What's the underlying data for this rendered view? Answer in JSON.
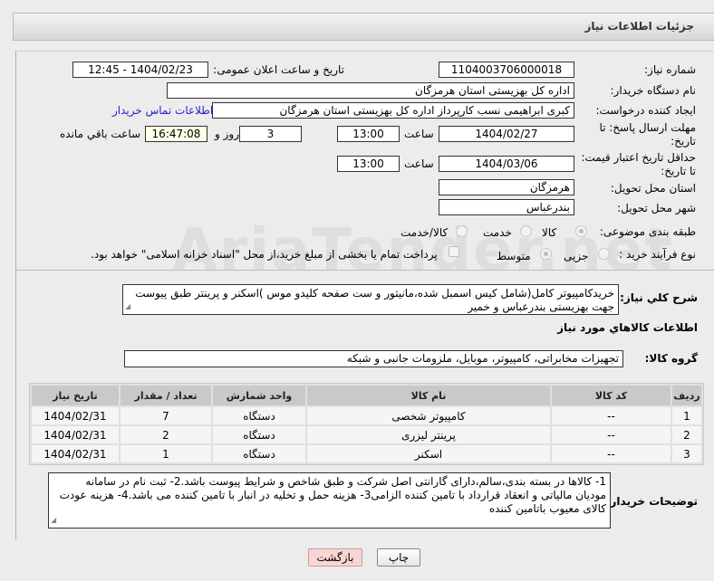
{
  "header": {
    "title": "جزئیات اطلاعات نیاز"
  },
  "form": {
    "need_number_label": "شماره نیاز:",
    "need_number": "1104003706000018",
    "announce_label": "تاریخ و ساعت اعلان عمومی:",
    "announce_value": "1404/02/23 - 12:45",
    "buyer_org_label": "نام دستگاه خریدار:",
    "buyer_org": "اداره کل بهزیستی استان هرمزگان",
    "creator_label": "ایجاد کننده درخواست:",
    "creator": "کبری  ابراهیمی نسب کارپرداز اداره کل بهزیستی استان هرمزگان",
    "contact_link": "اطلاعات تماس خریدار",
    "deadline_label": "مهلت ارسال پاسخ: تا تاریخ:",
    "deadline_date": "1404/02/27",
    "time_label": "ساعت",
    "deadline_time": "13:00",
    "days": "3",
    "days_label": "روز و",
    "remaining": "16:47:08",
    "remaining_label": "ساعت باقي مانده",
    "validity_label": "حداقل تاریخ اعتبار قیمت: تا تاریخ:",
    "validity_date": "1404/03/06",
    "validity_time": "13:00",
    "province_label": "استان محل تحویل:",
    "province": "هرمزگان",
    "city_label": "شهر محل تحویل:",
    "city": "بندرعباس",
    "category_label": "طبقه بندی موضوعی:",
    "category_options": [
      "کالا",
      "خدمت",
      "کالا/خدمت"
    ],
    "category_selected": "کالا",
    "process_label": "نوع فرآیند خرید :",
    "process_options": [
      "جزیی",
      "متوسط"
    ],
    "process_selected": "متوسط",
    "treasury_text": "پرداخت تمام یا بخشی از مبلغ خرید،از محل \"اسناد خزانه اسلامی\" خواهد بود.",
    "description_label": "شرح كلي نياز:",
    "description": "خریدکامپیوتر کامل(شامل کیس اسمبل شده،مانیتور و ست صفحه کلیدو موس )اسکنر و پرینتر طبق پیوست جهت بهزیستی بندرعباس و خمیر",
    "goods_section_title": "اطلاعات كالاهاي مورد نياز",
    "goods_group_label": "گروه کالا:",
    "goods_group": "تجهیزات مخابراتی، کامپیوتر، موبایل، ملزومات جانبی و شبکه"
  },
  "table": {
    "headers": [
      "ردیف",
      "کد کالا",
      "نام کالا",
      "واحد شمارش",
      "تعداد / مقدار",
      "تاریخ نیاز"
    ],
    "rows": [
      [
        "1",
        "--",
        "کامپیوتر شخصی",
        "دستگاه",
        "7",
        "1404/02/31"
      ],
      [
        "2",
        "--",
        "پرینتر لیزری",
        "دستگاه",
        "2",
        "1404/02/31"
      ],
      [
        "3",
        "--",
        "اسکنر",
        "دستگاه",
        "1",
        "1404/02/31"
      ]
    ]
  },
  "notes": {
    "label": "توضیحات خریدار:",
    "text": "1- کالاها در بسته بندی،سالم،دارای گارانتی اصل شرکت و طبق شاخص و شرایط پیوست باشد.2- ثبت نام در سامانه مودیان مالیاتی و انعقاد قرارداد با تامین کننده الزامی3- هزینه حمل و تخلیه در انبار با تامین کننده می باشد.4- هزینه عودت کالای معیوب باتامین کننده"
  },
  "buttons": {
    "print": "چاپ",
    "back": "بازگشت"
  },
  "colors": {
    "link": "#2222cc",
    "back_button": "#f9d6d6",
    "remaining_bg": "#ffffe8"
  }
}
